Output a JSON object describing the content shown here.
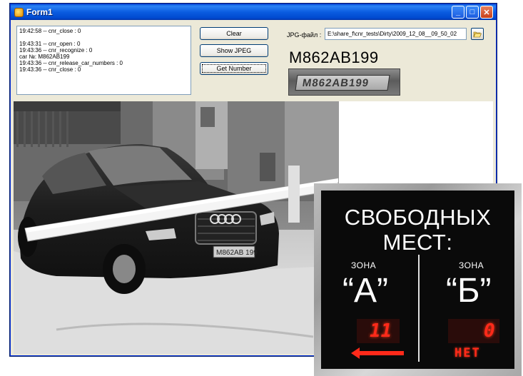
{
  "window": {
    "title": "Form1",
    "minimize_glyph": "_",
    "maximize_glyph": "□",
    "close_glyph": "✕"
  },
  "log": {
    "lines": [
      "19:42:58 -- cnr_close : 0",
      "",
      "19:43:31 -- cnr_open : 0",
      "19:43:36 -- cnr_recognize : 0",
      "car №: M862AB199",
      "19:43:36 -- cnr_release_car_numbers : 0",
      "19:43:36 -- cnr_close : 0"
    ]
  },
  "buttons": {
    "clear": "Clear",
    "show_jpeg": "Show JPEG",
    "get_number": "Get Number"
  },
  "jpg": {
    "label": "JPG-файл :",
    "path": "E:\\share_f\\cnr_tests\\Dirty\\2009_12_08__09_50_02"
  },
  "result": {
    "plate_number": "M862AB199",
    "crop_text": "M862AB199"
  },
  "photo": {
    "license_plate": "M862AB 199"
  },
  "sign": {
    "line1": "СВОБОДНЫХ",
    "line2": "МЕСТ:",
    "zone_a_word": "ЗОНА",
    "zone_a_letter": "“А”",
    "zone_b_word": "ЗОНА",
    "zone_b_letter": "“Б”",
    "zone_a_count": "11",
    "zone_b_count": "0",
    "zone_b_status": "НЕТ"
  },
  "colors": {
    "titlebar": "#0a5ce0",
    "window_bg": "#ece9d8",
    "led_red": "#ff2a1a"
  }
}
